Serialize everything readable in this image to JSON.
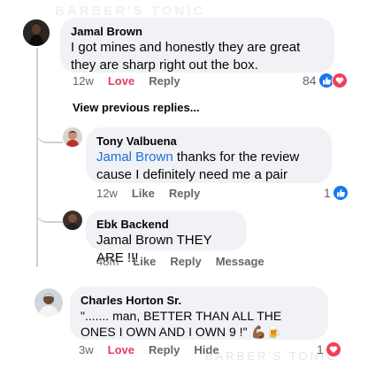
{
  "watermark": {
    "top": "BARBER'S TONIC",
    "bottom": "BARBER'S TONIC"
  },
  "comments": [
    {
      "author": "Jamal Brown",
      "text": "I got mines and honestly they are great they are sharp right out the box.",
      "time": "12w",
      "love_label": "Love",
      "reply_label": "Reply",
      "reaction_count": "84",
      "reaction_icons": [
        "like-icon",
        "love-icon"
      ]
    },
    {
      "author": "Tony Valbuena",
      "mention": "Jamal Brown",
      "text": " thanks for the review cause I definitely need me a pair",
      "time": "12w",
      "like_label": "Like",
      "reply_label": "Reply",
      "reaction_count": "1",
      "reaction_icons": [
        "like-icon"
      ]
    },
    {
      "author": "Ebk Backend",
      "text": "Jamal Brown THEY ARE !!!",
      "time": "48m",
      "like_label": "Like",
      "reply_label": "Reply",
      "message_label": "Message"
    },
    {
      "author": "Charles Horton Sr.",
      "text": "\"....... man, BETTER THAN ALL THE ONES I OWN AND I OWN 9 !\"",
      "emoji": "💪🏾🍺",
      "time": "3w",
      "love_label": "Love",
      "reply_label": "Reply",
      "hide_label": "Hide",
      "reaction_count": "1",
      "reaction_icons": [
        "love-icon"
      ]
    }
  ],
  "view_previous_replies": "View previous replies...",
  "colors": {
    "like": "#1877f2",
    "love": "#f33e58",
    "mention": "#216fdb",
    "bubble": "#f0f2f5"
  }
}
